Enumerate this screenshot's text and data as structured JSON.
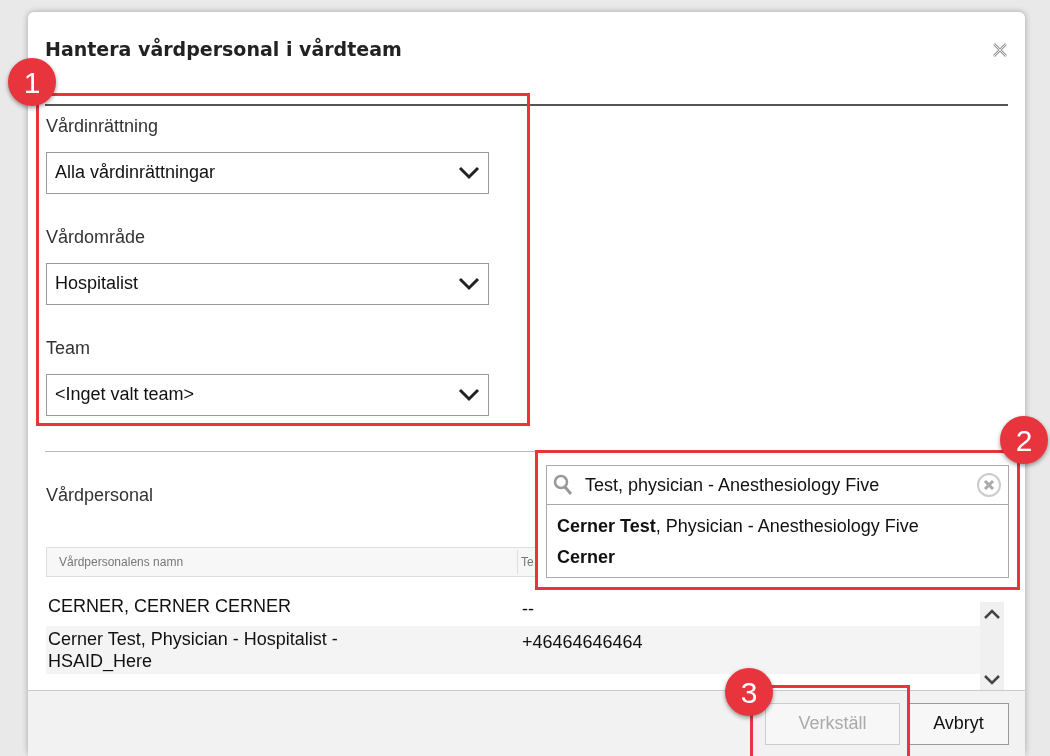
{
  "dialog": {
    "title": "Hantera vårdpersonal i vårdteam"
  },
  "filters": [
    {
      "label": "Vårdinrättning",
      "value": "Alla vårdinrättningar"
    },
    {
      "label": "Vårdområde",
      "value": "Hospitalist"
    },
    {
      "label": "Team",
      "value": "<Inget valt team>"
    }
  ],
  "staff_section": {
    "label": "Vårdpersonal"
  },
  "search": {
    "value": "Test, physician - Anesthesiology Five",
    "suggestions": [
      "**Cerner Test**, Physician - Anesthesiology Five",
      "**Cerner**"
    ]
  },
  "table": {
    "columns": [
      "Vårdpersonalens namn",
      "Te"
    ],
    "rows": [
      [
        "CERNER, CERNER CERNER",
        "--"
      ],
      [
        "Cerner Test, Physician - Hospitalist - HSAID_Here",
        "+46464646464"
      ]
    ]
  },
  "buttons": [
    {
      "label": "Verkställ",
      "disabled": true
    },
    {
      "label": "Avbryt",
      "disabled": false
    }
  ],
  "callouts": [
    {
      "number": "1"
    },
    {
      "number": "2"
    },
    {
      "number": "3"
    }
  ]
}
